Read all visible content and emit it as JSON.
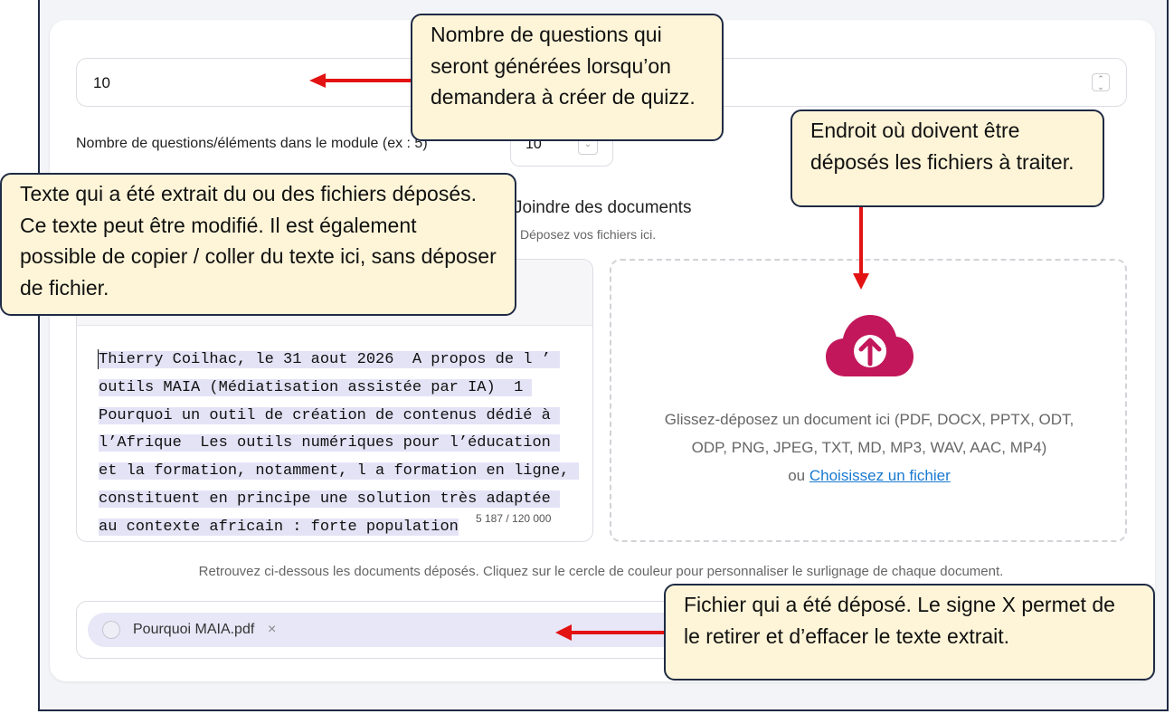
{
  "form": {
    "question_count_value": "10",
    "module_label": "Nombre de questions/éléments dans le module (ex : 5)",
    "module_value": "10",
    "attach_title": "Joindre des documents",
    "attach_subtitle": "Déposez vos fichiers ici."
  },
  "editor": {
    "text": "Thierry Coilhac, le 31 aout 2026  A propos de l ’ outils MAIA (Médiatisation assistée par IA)  1 Pourquoi un outil de création de contenus dédié à l’Afrique  Les outils numériques pour l’éducation et la formation, notamment, l a formation en ligne, constituent en principe une solution très adaptée au contexte africain : forte population",
    "counter": "5 187 / 120 000"
  },
  "dropzone": {
    "line1": "Glissez-déposez un document ici (PDF, DOCX, PPTX, ODT,",
    "line2": "ODP, PNG, JPEG, TXT, MD, MP3, WAV, AAC, MP4)",
    "or_text": "ou",
    "choose_link": "Choisissez un fichier"
  },
  "files": {
    "note": "Retrouvez ci-dessous les documents déposés. Cliquez sur le cercle de couleur pour personnaliser le surlignage de chaque document.",
    "items": [
      {
        "name": "Pourquoi MAIA.pdf",
        "remove": "×"
      }
    ]
  },
  "annotations": {
    "questions": "Nombre de questions qui seront générées lorsqu’on demandera à créer de quizz.",
    "dropzone": "Endroit où doivent être déposés les fichiers à traiter.",
    "text": "Texte qui a été extrait du ou des  fichiers déposés.  Ce texte peut être modifié. Il est également possible de copier / coller du texte ici, sans déposer de fichier.",
    "file": "Fichier qui a été déposé. Le signe X permet de le retirer et d’effacer le texte extrait."
  },
  "colors": {
    "cloud": "#c2185b",
    "arrow": "#e31313",
    "callout_bg": "#fef5d8",
    "chip_bg": "#e8e7f7",
    "link": "#1a7ad1"
  }
}
